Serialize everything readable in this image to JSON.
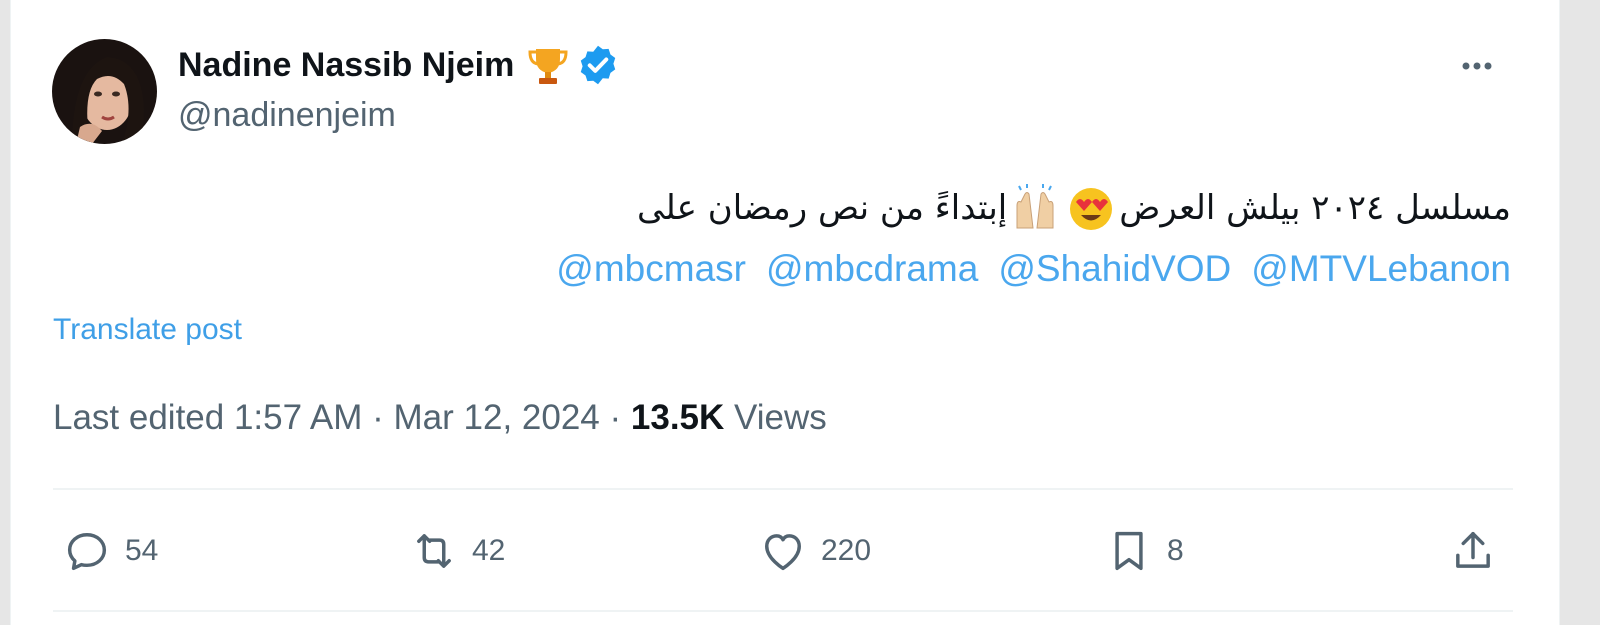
{
  "author": {
    "name": "Nadine Nassib Njeim",
    "handle": "@nadinenjeim"
  },
  "tweet": {
    "text_part1": "مسلسل ٢٠٢٤ بيلش العرض",
    "text_part2": "إبتداءً من نص رمضان على",
    "mentions": [
      "@MTVLebanon",
      "@ShahidVOD",
      "@mbcdrama",
      "@mbcmasr"
    ]
  },
  "translate_label": "Translate post",
  "meta": {
    "edited_time": "Last edited 1:57 AM",
    "sep1": "·",
    "date": "Mar 12, 2024",
    "sep2": "·",
    "views_count": "13.5K",
    "views_label": "Views"
  },
  "actions": {
    "replies": "54",
    "reposts": "42",
    "likes": "220",
    "bookmarks": "8"
  },
  "icons": {
    "more": "more-dots-icon",
    "verified": "verified-badge-icon",
    "trophy": "trophy-icon",
    "reply": "reply-icon",
    "repost": "repost-icon",
    "like": "heart-icon",
    "bookmark": "bookmark-icon",
    "share": "share-icon"
  },
  "colors": {
    "link": "#4aa7ee",
    "verified": "#1d9bf0",
    "muted": "#536471",
    "text": "#0f1419"
  }
}
